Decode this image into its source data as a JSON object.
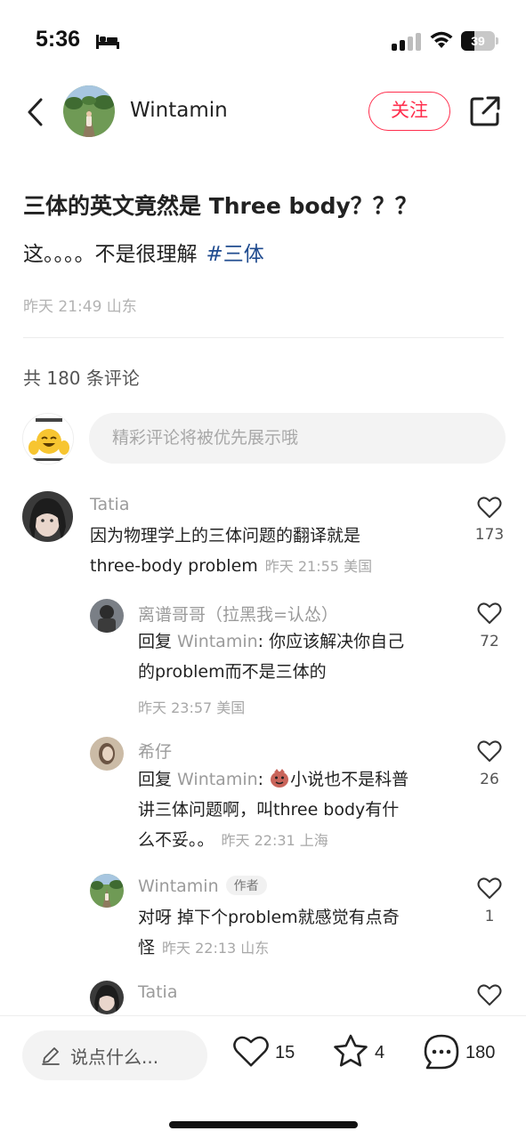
{
  "status_bar": {
    "time": "5:36",
    "battery": "39",
    "battery_level": 0.39
  },
  "header": {
    "author_name": "Wintamin",
    "follow_label": "关注"
  },
  "post": {
    "title": "三体的英文竟然是 Three body？？？",
    "body": "这。。。。不是很理解",
    "hashtag": "#三体",
    "meta": "昨天 21:49 山东"
  },
  "comments_section": {
    "count_label": "共 180 条评论",
    "input_placeholder": "精彩评论将被优先展示哦"
  },
  "comments": [
    {
      "name": "Tatia",
      "line1": "因为物理学上的三体问题的翻译就是",
      "line2": "three-body problem",
      "meta": "昨天 21:55 美国",
      "likes": "173"
    },
    {
      "name": "离谱哥哥（拉黑我=认怂）",
      "reply_prefix": "回复 ",
      "reply_to": "Wintamin",
      "line1": ": 你应该解决你自己",
      "line2": "的problem而不是三体的",
      "meta": "昨天 23:57 美国",
      "likes": "72"
    },
    {
      "name": "希仔",
      "reply_prefix": "回复 ",
      "reply_to": "Wintamin",
      "line1": "小说也不是科普",
      "line2": "讲三体问题啊，叫three body有什",
      "line3": "么不妥。。",
      "meta": "昨天 22:31 上海",
      "likes": "26"
    },
    {
      "name": "Wintamin",
      "badge": "作者",
      "line1": "对呀 掉下个problem就感觉有点奇",
      "line2": "怪",
      "meta": "昨天 22:13 山东",
      "likes": "1"
    },
    {
      "name": "Tatia"
    }
  ],
  "bottom_bar": {
    "input_label": "说点什么...",
    "likes": "15",
    "favorites": "4",
    "comments": "180"
  },
  "colors": {
    "accent_red": "#ff2e4d",
    "hashtag_blue": "#1f4b8f",
    "muted_gray": "#9b9b9b"
  },
  "icons": [
    "back-arrow-icon",
    "share-icon",
    "heart-icon",
    "star-icon",
    "comment-bubble-icon",
    "pen-icon",
    "wifi-icon",
    "signal-icon",
    "bed-icon"
  ]
}
